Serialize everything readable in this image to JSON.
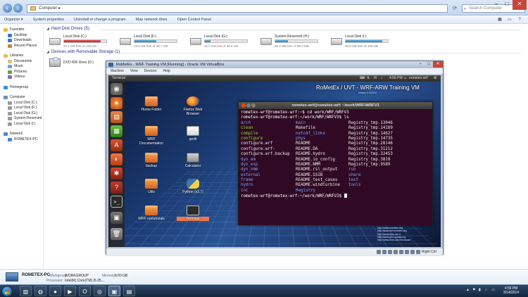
{
  "explorer": {
    "address": "Computer",
    "search_placeholder": "Search Computer",
    "toolbar": [
      "Organize ▾",
      "System properties",
      "Uninstall or change a program",
      "Map network drive",
      "Open Control Panel"
    ],
    "sidebar": [
      {
        "label": "Favorites",
        "head": true,
        "color": "#e9b93a"
      },
      {
        "label": "Desktop",
        "head": false,
        "color": "#3d78c9"
      },
      {
        "label": "Downloads",
        "head": false,
        "color": "#3d78c9"
      },
      {
        "label": "Recent Places",
        "head": false,
        "color": "#b98a34"
      },
      {
        "gap": true
      },
      {
        "label": "Libraries",
        "head": true,
        "color": "#e3c262"
      },
      {
        "label": "Documents",
        "head": false,
        "color": "#d9c27a"
      },
      {
        "label": "Music",
        "head": false,
        "color": "#6da3e3"
      },
      {
        "label": "Pictures",
        "head": false,
        "color": "#5fa35a"
      },
      {
        "label": "Videos",
        "head": false,
        "color": "#806ab5"
      },
      {
        "gap": true
      },
      {
        "label": "Homegroup",
        "head": true,
        "color": "#3e8ed8"
      },
      {
        "gap": true
      },
      {
        "label": "Computer",
        "head": true,
        "color": "#6d8fb8"
      },
      {
        "label": "Local Disk (C:)",
        "head": false,
        "color": "#9a9a9a"
      },
      {
        "label": "Local Disk (F:)",
        "head": false,
        "color": "#9a9a9a"
      },
      {
        "label": "Local Disk (G:)",
        "head": false,
        "color": "#9a9a9a"
      },
      {
        "label": "System Reserved (H:)",
        "head": false,
        "color": "#9a9a9a"
      },
      {
        "label": "Local Disk (I:)",
        "head": false,
        "color": "#9a9a9a"
      },
      {
        "gap": true
      },
      {
        "label": "Network",
        "head": true,
        "color": "#4f86c6"
      },
      {
        "label": "ROMETEX-PC",
        "head": false,
        "color": "#4f86c6"
      }
    ],
    "hdd_group": "Hard Disk Drives (5)",
    "removable_group": "Devices with Removable Storage (1)",
    "drives": [
      {
        "name": "Local Disk (C:)",
        "free": "20.2 GB free of 146 GB",
        "used_fraction": 0.86,
        "red": true
      },
      {
        "name": "Local Disk (F:)",
        "free": "23.5 GB free of 48.7 GB",
        "used_fraction": 0.52,
        "red": false
      },
      {
        "name": "Local Disk (G:)",
        "free": "42.0 GB free of 48.8 GB",
        "used_fraction": 0.14,
        "red": false
      },
      {
        "name": "System Reserved (H:)",
        "free": "69.2 MB free of 99.0 MB",
        "used_fraction": 0.3,
        "red": false
      },
      {
        "name": "Local Disk (I:)",
        "free": "28.8 GB free of 200 GB",
        "used_fraction": 0.86,
        "red": false
      }
    ],
    "dvd": "DVD RW Drive (D:)"
  },
  "vbox": {
    "title": "RoMetEx - WRF Training VM [Running] - Oracle VM VirtualBox",
    "menu": [
      "Machine",
      "View",
      "Devices",
      "Help"
    ],
    "host_key": "Right Ctrl",
    "guest": {
      "topbar_label": "Terminal",
      "time": "4:56 PM",
      "user": "rometex-wrf",
      "branding": "RoMetEx / UVT - WRF-ARW Training VM",
      "branding_sub": "version 0.3/2014",
      "desktop_icons": [
        {
          "label": "Home Folder",
          "kind": "folder"
        },
        {
          "label": "Firefox Web Browser",
          "kind": "firefox"
        },
        {
          "label": "WRF Documentation",
          "kind": "folder"
        },
        {
          "label": "gedit",
          "kind": "gedit"
        },
        {
          "label": "backup",
          "kind": "folder"
        },
        {
          "label": "Calculator",
          "kind": "calc"
        },
        {
          "label": "Utils",
          "kind": "folder"
        },
        {
          "label": "Python (v2.7)",
          "kind": "python"
        },
        {
          "label": "WRF runtutorials",
          "kind": "folder"
        },
        {
          "label": "Terminal",
          "kind": "terminal"
        }
      ],
      "links": [
        "http://www.rometex.org",
        "http://www.wrf-rometex.org",
        "http://www.itpm.uvt.ro",
        "http://www.geo-spatial.org",
        "http://www.wmo-sat.info/oscar/"
      ]
    },
    "terminal": {
      "title": "rometex-wrf@rometex-wrf: ~/work/WRF/WRFV3",
      "lines": [
        {
          "text": "rometex-wrf@rometex-wrf:~$ cd work/WRF/WRFV3"
        },
        {
          "text": "rometex-wrf@rometex-wrf:~/work/WRF/WRFV3$ ls"
        }
      ],
      "ls_rows": [
        [
          {
            "t": "arch",
            "c": "dir"
          },
          {
            "t": "main",
            "c": "dir"
          },
          {
            "t": "Registry_tmp.13046",
            "c": "file"
          }
        ],
        [
          {
            "t": "clean",
            "c": "exe"
          },
          {
            "t": "Makefile",
            "c": "file"
          },
          {
            "t": "Registry_tmp.14189",
            "c": "file"
          }
        ],
        [
          {
            "t": "compile",
            "c": "exe"
          },
          {
            "t": "netcdf_links",
            "c": "dir"
          },
          {
            "t": "Registry_tmp.14627",
            "c": "file"
          }
        ],
        [
          {
            "t": "configure",
            "c": "exe"
          },
          {
            "t": "phys",
            "c": "dir"
          },
          {
            "t": "Registry_tmp.14735",
            "c": "file"
          }
        ],
        [
          {
            "t": "configure.wrf",
            "c": "file"
          },
          {
            "t": "README",
            "c": "file"
          },
          {
            "t": "Registry_tmp.28146",
            "c": "file"
          }
        ],
        [
          {
            "t": "configure.wrf-",
            "c": "file"
          },
          {
            "t": "README.DA",
            "c": "file"
          },
          {
            "t": "Registry_tmp.31212",
            "c": "file"
          }
        ],
        [
          {
            "t": "configure.wrf.backup",
            "c": "file"
          },
          {
            "t": "README.hydro",
            "c": "file"
          },
          {
            "t": "Registry_tmp.32453",
            "c": "file"
          }
        ],
        [
          {
            "t": "dyn_em",
            "c": "dir"
          },
          {
            "t": "README.io_config",
            "c": "file"
          },
          {
            "t": "Registry_tmp.3819",
            "c": "file"
          }
        ],
        [
          {
            "t": "dyn_exp",
            "c": "dir"
          },
          {
            "t": "README.NMM",
            "c": "file"
          },
          {
            "t": "Registry_tmp.9589",
            "c": "file"
          }
        ],
        [
          {
            "t": "dyn_nmm",
            "c": "dir"
          },
          {
            "t": "README.rsl_output",
            "c": "file"
          },
          {
            "t": "run",
            "c": "dir"
          }
        ],
        [
          {
            "t": "external",
            "c": "dir"
          },
          {
            "t": "README.SSIB",
            "c": "file"
          },
          {
            "t": "share",
            "c": "dir"
          }
        ],
        [
          {
            "t": "frame",
            "c": "dir"
          },
          {
            "t": "README_test_cases",
            "c": "file"
          },
          {
            "t": "test",
            "c": "dir"
          }
        ],
        [
          {
            "t": "hydro",
            "c": "dir"
          },
          {
            "t": "README.windturbine",
            "c": "file"
          },
          {
            "t": "tools",
            "c": "dir"
          }
        ],
        [
          {
            "t": "inc",
            "c": "dir"
          },
          {
            "t": "Registry",
            "c": "dir"
          },
          {
            "t": "",
            "c": "file"
          }
        ]
      ],
      "prompt": "rometex-wrf@rometex-wrf:~/work/WRF/WRFV3$ "
    }
  },
  "details": {
    "pc_name": "ROMETEX-PC",
    "workgroup_label": "Workgroup:",
    "workgroup": "WORKGROUP",
    "memory_label": "Memory:",
    "memory": "8.00 GB",
    "processor_label": "Processor:",
    "processor": "Intel(R) Core(TM) i5-25..."
  },
  "taskbar": {
    "time": "4:56 PM",
    "date": "3/14/2014"
  },
  "colors": {
    "terminal_bg": "#300a24",
    "ubuntu_accent": "#f07746",
    "dir": "#7fa7ff",
    "exe": "#8ae234"
  }
}
